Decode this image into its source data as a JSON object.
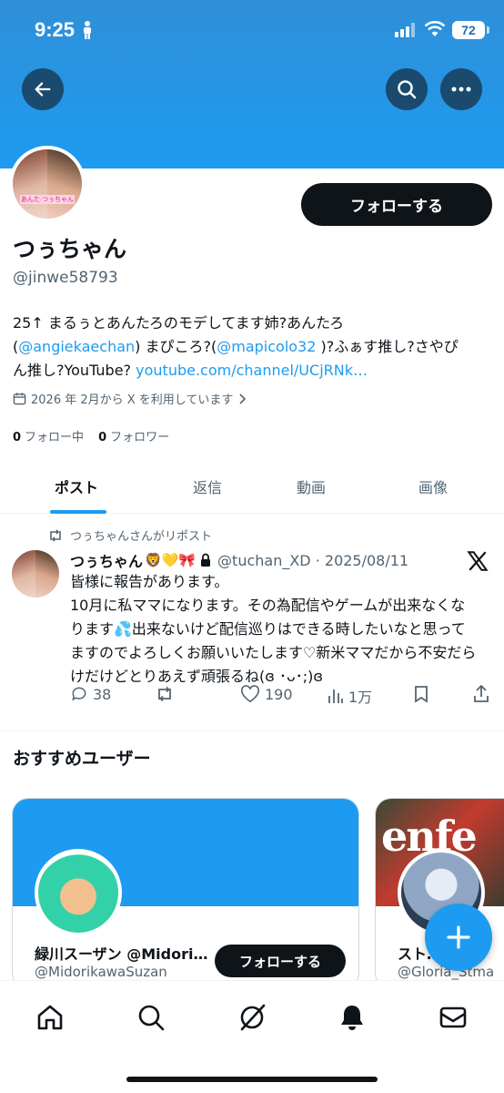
{
  "status_bar": {
    "time": "9:25",
    "battery": "72"
  },
  "profile": {
    "display_name": "つぅちゃん",
    "handle": "@jinwe58793",
    "follow_label": "フォローする",
    "bio_text1": "25↑ まるぅとあんたろのモデしてます姉?あんたろ",
    "bio_text2": "(",
    "bio_link1": "@angiekaechan",
    "bio_text3": ") まぴころ?(",
    "bio_link2": "@mapicolo32",
    "bio_text4": " )?ふぁす推し?さやぴ",
    "bio_text5": "ん推し?YouTube? ",
    "bio_link3": "youtube.com/channel/UCjRNk…",
    "joined": "2026 年 2月から X を利用しています",
    "following_count": "0",
    "following_label": "フォロー中",
    "followers_count": "0",
    "followers_label": "フォロワー",
    "avatar_tag_left": "あんたろ",
    "avatar_tag_right": "つぅちゃん"
  },
  "tabs": [
    "ポスト",
    "返信",
    "動画",
    "画像"
  ],
  "post": {
    "repost_label": "つぅちゃんさんがリポスト",
    "author_name": "つぅちゃん",
    "author_emoji": "🦁💛🎀",
    "author_meta": "@tuchan_XD · 2025/08/11",
    "line1": "皆様に報告があります。",
    "line2": "10月に私ママになります。その為配信やゲームが出来なくな",
    "line3": "ります💦出来ないけど配信巡りはできる時したいなと思って",
    "line4": "ますのでよろしくお願いいたします♡新米ママだから不安だら",
    "line5": "けだけどとりあえず頑張るね(ɞ ･ᴗ･;)ɞ",
    "replies": "38",
    "likes": "190",
    "views": "1万"
  },
  "recommended": {
    "title": "おすすめユーザー",
    "cards": [
      {
        "name": "緑川スーザン @Midori…",
        "handle": "@MidorikawaSuzan",
        "follow_label": "フォローする"
      },
      {
        "name": "スト…パ",
        "handle": "@Gloria_Stma",
        "banner_text": "enfe"
      }
    ]
  },
  "colors": {
    "accent": "#1d9bf0",
    "text": "#0f1419",
    "muted": "#536471"
  },
  "icons": [
    "back-arrow-icon",
    "search-icon",
    "more-icon",
    "calendar-icon",
    "chevron-right-icon",
    "repost-icon",
    "lock-icon",
    "x-logo-icon",
    "reply-icon",
    "like-icon",
    "views-icon",
    "bookmark-icon",
    "share-icon",
    "compose-plus-icon",
    "home-icon",
    "grok-icon",
    "bell-icon",
    "mail-icon"
  ]
}
